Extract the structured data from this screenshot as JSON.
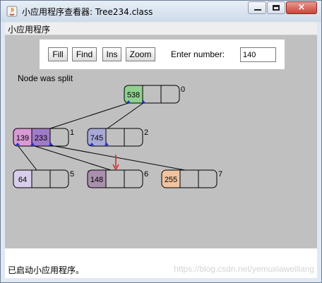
{
  "window": {
    "title": "小应用程序查看器: Tree234.class",
    "close_glyph": "×"
  },
  "menu": {
    "applet_label": "小应用程序"
  },
  "toolbar": {
    "buttons": [
      "Fill",
      "Find",
      "Ins",
      "Zoom"
    ],
    "enter_label": "Enter number:",
    "input_value": "140"
  },
  "canvas": {
    "message": "Node was split",
    "nodes": [
      {
        "index": "0",
        "values": [
          "538",
          "",
          ""
        ],
        "colors": [
          "#8fd18f",
          "",
          ""
        ]
      },
      {
        "index": "1",
        "values": [
          "139",
          "233",
          ""
        ],
        "colors": [
          "#d99ad6",
          "#a07bc8",
          ""
        ]
      },
      {
        "index": "2",
        "values": [
          "745",
          "",
          ""
        ],
        "colors": [
          "#a9a9d8",
          "",
          ""
        ]
      },
      {
        "index": "5",
        "values": [
          "64",
          "",
          ""
        ],
        "colors": [
          "#d8cdea",
          "",
          ""
        ]
      },
      {
        "index": "6",
        "values": [
          "148",
          "",
          ""
        ],
        "colors": [
          "#a990ad",
          "",
          ""
        ]
      },
      {
        "index": "7",
        "values": [
          "255",
          "",
          ""
        ],
        "colors": [
          "#f1c3a0",
          "",
          ""
        ]
      }
    ]
  },
  "status": {
    "text": "已启动小应用程序。",
    "watermark": "https://blog.csdn.net/yemuxiaweiliang"
  }
}
